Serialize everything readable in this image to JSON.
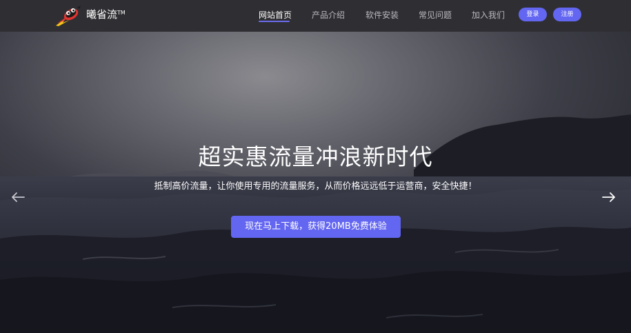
{
  "header": {
    "brand_name": "曦省流",
    "brand_mark": "TM",
    "nav": [
      {
        "label": "网站首页",
        "active": true
      },
      {
        "label": "产品介绍",
        "active": false
      },
      {
        "label": "软件安装",
        "active": false
      },
      {
        "label": "常见问题",
        "active": false
      },
      {
        "label": "加入我们",
        "active": false
      }
    ],
    "login_label": "登录",
    "register_label": "注册"
  },
  "hero": {
    "title": "超实惠流量冲浪新时代",
    "subtitle": "抵制高价流量，让你使用专用的流量服务，从而价格远远低于运营商，安全快捷！",
    "cta_label": "现在马上下载，获得20MB免费体验",
    "prev_icon": "arrow-left-icon",
    "next_icon": "arrow-right-icon"
  },
  "colors": {
    "nav_bg": "#2f2f33",
    "accent": "#6366f1",
    "nav_text": "#b9b9be",
    "nav_active": "#ffffff"
  }
}
